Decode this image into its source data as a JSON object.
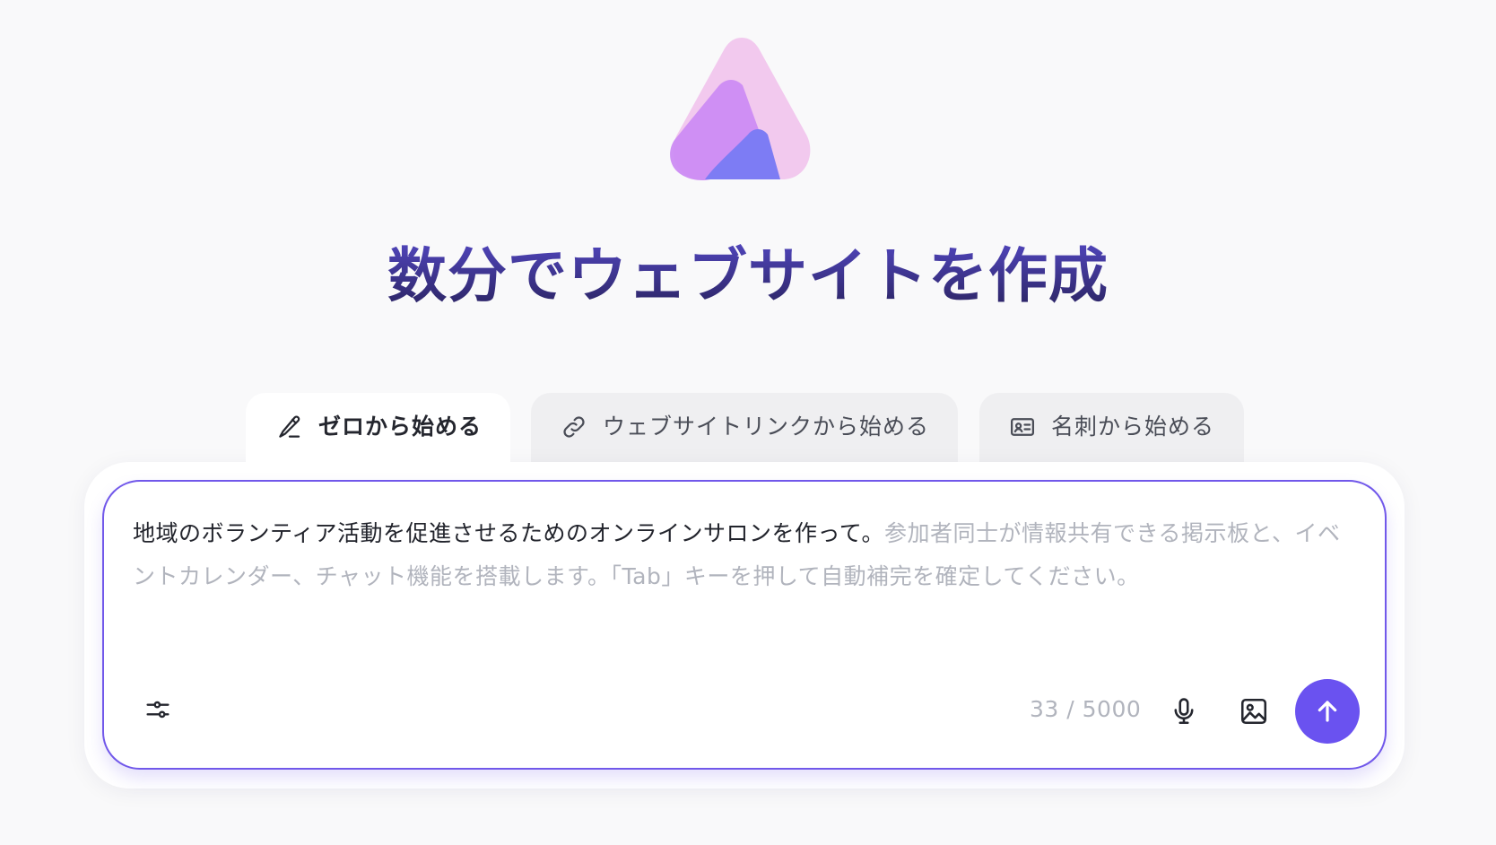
{
  "brand": {
    "logo_icon": "brand-logo-icon",
    "colors": {
      "logo_light": "#f2c9ee",
      "logo_mid": "#cc8cf3",
      "logo_dark": "#7d7cf4",
      "accent": "#6a52f0"
    }
  },
  "header": {
    "title": "数分でウェブサイトを作成"
  },
  "tabs": [
    {
      "label": "ゼロから始める",
      "icon": "pencil-icon",
      "active": true
    },
    {
      "label": "ウェブサイトリンクから始める",
      "icon": "link-icon",
      "active": false
    },
    {
      "label": "名刺から始める",
      "icon": "id-card-icon",
      "active": false
    }
  ],
  "composer": {
    "typed_text": "地域のボランティア活動を促進させるためのオンラインサロンを作って。",
    "suggestion_text": "参加者同士が情報共有できる掲示板と、イベントカレンダー、チャット機能を搭載します。「Tab」キーを押して自動補完を確定してください。",
    "char_count": "33 / 5000",
    "settings_icon": "sliders-icon",
    "mic_icon": "microphone-icon",
    "image_icon": "image-icon",
    "send_icon": "arrow-up-icon"
  }
}
